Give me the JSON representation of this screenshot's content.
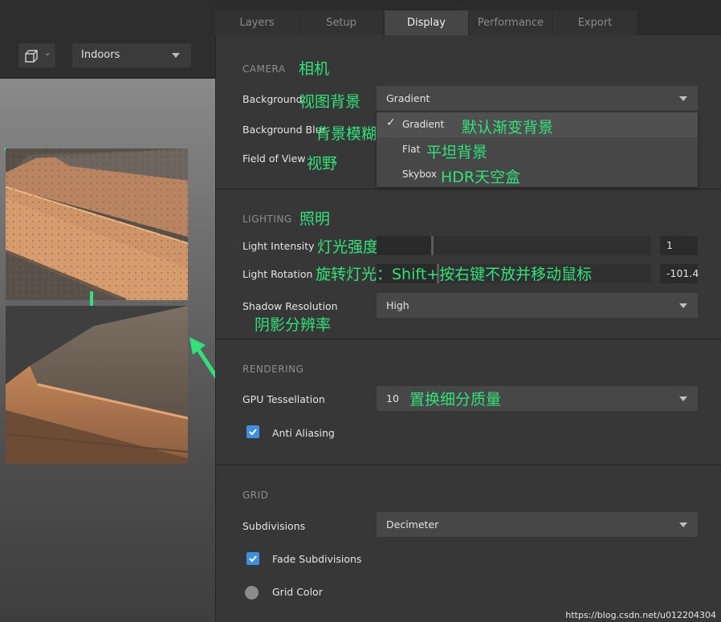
{
  "colors": {
    "accent": "#3d8fe0",
    "annotation": "#2fe37a",
    "panel_bg": "#373737",
    "tab_active": "#464646"
  },
  "viewport": {
    "view_icon": "cube-icon",
    "environment": {
      "selected": "Indoors"
    }
  },
  "tabs": [
    {
      "label": "Layers",
      "active": false
    },
    {
      "label": "Setup",
      "active": false
    },
    {
      "label": "Display",
      "active": true
    },
    {
      "label": "Performance",
      "active": false
    },
    {
      "label": "Export",
      "active": false
    }
  ],
  "camera": {
    "title": "CAMERA",
    "title_note": "相机",
    "background_label": "Background",
    "background_note": "视图背景",
    "background_value": "Gradient",
    "background_options": [
      {
        "label": "Gradient",
        "note": "默认渐变背景",
        "selected": true
      },
      {
        "label": "Flat",
        "note": "平坦背景",
        "selected": false
      },
      {
        "label": "Skybox",
        "note": "HDR天空盒",
        "selected": false
      }
    ],
    "blur_label": "Background Blur",
    "blur_note": "背景模糊",
    "fov_label": "Field of View",
    "fov_note": "视野"
  },
  "lighting": {
    "title": "LIGHTING",
    "title_note": "照明",
    "intensity_label": "Light Intensity",
    "intensity_note": "灯光强度",
    "intensity_value": "1",
    "intensity_fraction": 0.2,
    "rotation_label": "Light Rotation",
    "rotation_note": "旋转灯光：Shift+按右键不放并移动鼠标",
    "rotation_value": "-101.4",
    "rotation_fraction": 0.22,
    "shadow_label": "Shadow Resolution",
    "shadow_note": "阴影分辨率",
    "shadow_value": "High"
  },
  "rendering": {
    "title": "RENDERING",
    "tess_label": "GPU Tessellation",
    "tess_value": "10",
    "tess_note": "置换细分质量",
    "aa_label": "Anti Aliasing",
    "aa_checked": true
  },
  "grid": {
    "title": "GRID",
    "subdiv_label": "Subdivisions",
    "subdiv_value": "Decimeter",
    "fade_label": "Fade Subdivisions",
    "fade_checked": true,
    "color_label": "Grid Color",
    "color_value": "#8b8b8b"
  },
  "watermark": "https://blog.csdn.net/u012204304"
}
